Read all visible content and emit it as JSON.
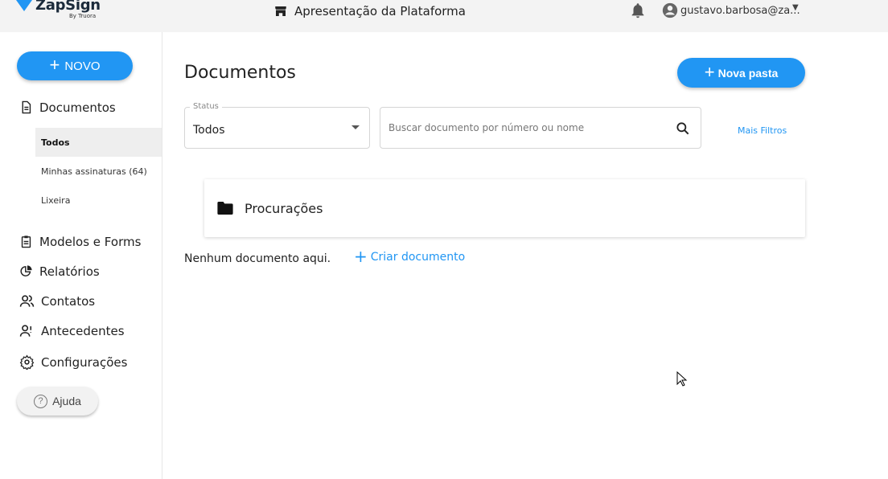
{
  "header": {
    "logo_text": "ZapSign",
    "logo_sub": "By Truora",
    "org_name": "Apresentação da Plataforma",
    "user_email": "gustavo.barbosa@za..."
  },
  "sidebar": {
    "new_button": "NOVO",
    "items": [
      {
        "label": "Documentos",
        "icon": "document-icon"
      },
      {
        "label": "Modelos e Forms",
        "icon": "clipboard-icon"
      },
      {
        "label": "Relatórios",
        "icon": "pie-chart-icon"
      },
      {
        "label": "Contatos",
        "icon": "people-icon"
      },
      {
        "label": "Antecedentes",
        "icon": "person-search-icon"
      },
      {
        "label": "Configurações",
        "icon": "gear-icon"
      }
    ],
    "sub_items": [
      {
        "label": "Todos",
        "active": true
      },
      {
        "label": "Minhas assinaturas (64)",
        "active": false
      },
      {
        "label": "Lixeira",
        "active": false
      }
    ],
    "help_button": "Ajuda"
  },
  "main": {
    "title": "Documentos",
    "new_folder_button": "Nova pasta",
    "status_filter": {
      "label": "Status",
      "value": "Todos"
    },
    "search": {
      "placeholder": "Buscar documento por número ou nome"
    },
    "more_filters": "Mais Filtros",
    "folders": [
      {
        "name": "Procurações"
      }
    ],
    "empty_message": "Nenhum documento aqui.",
    "create_document": "Criar documento"
  },
  "colors": {
    "accent": "#2196f3",
    "topbar": "#f3f3f3"
  }
}
